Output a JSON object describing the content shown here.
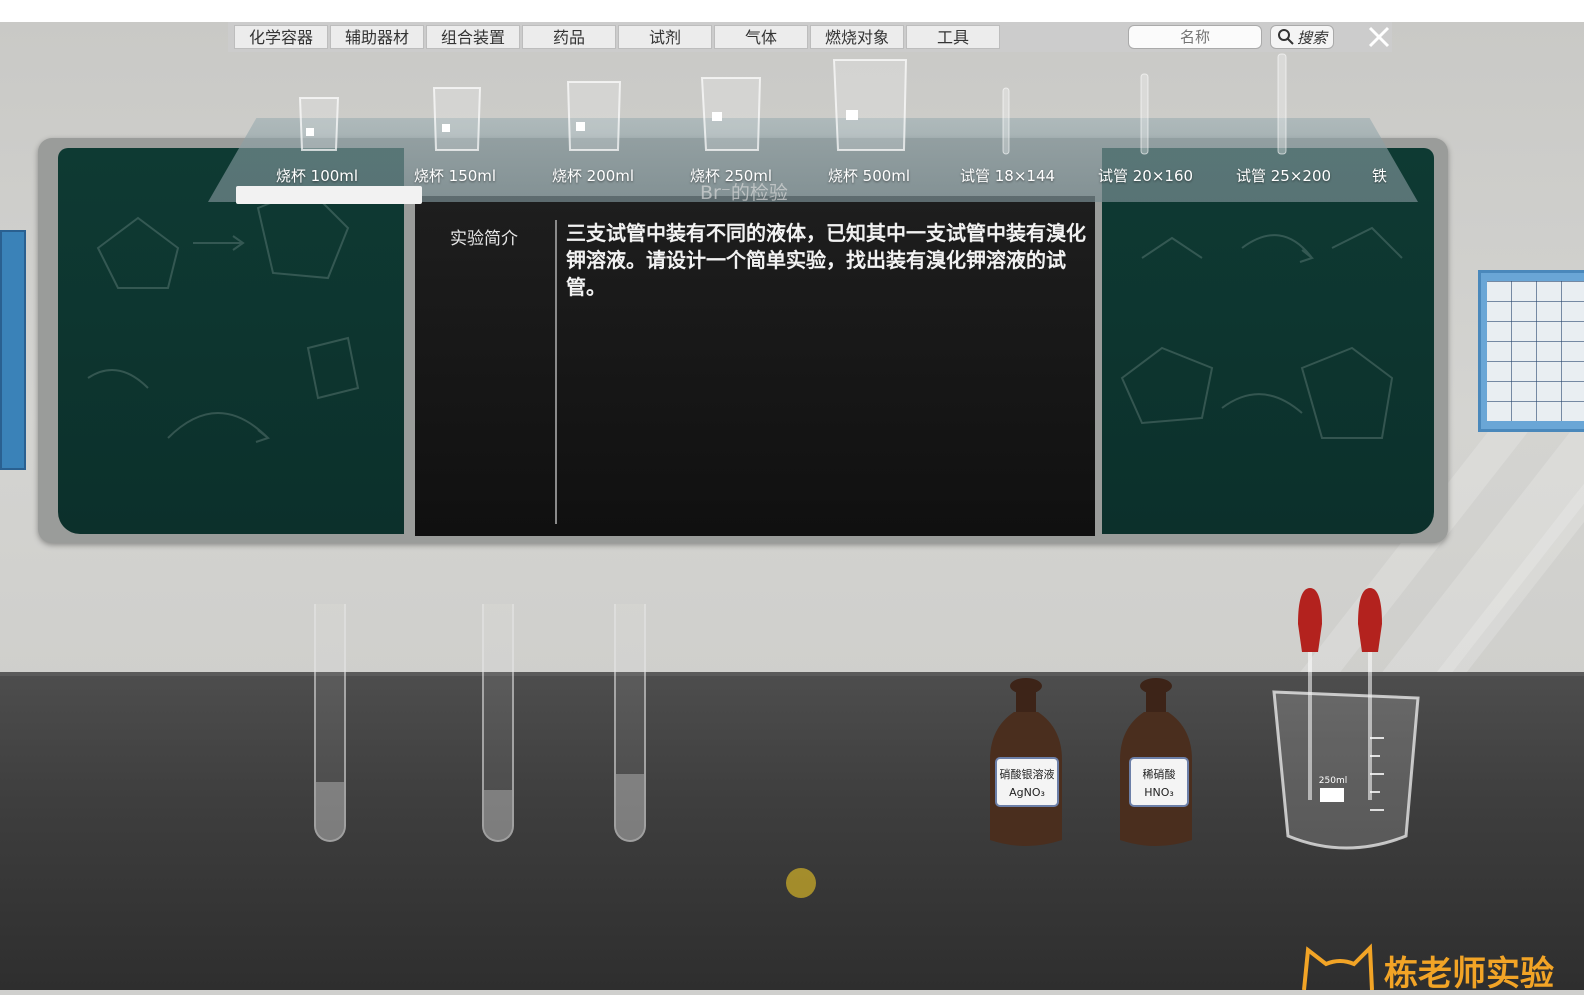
{
  "menu": {
    "tabs": [
      "化学容器",
      "辅助器材",
      "组合装置",
      "药品",
      "试剂",
      "气体",
      "燃烧对象",
      "工具"
    ]
  },
  "search": {
    "placeholder": "名称",
    "button_label": "搜索"
  },
  "shelf": {
    "items": [
      {
        "label": "烧杯 100ml",
        "icon": "beaker-icon"
      },
      {
        "label": "烧杯 150ml",
        "icon": "beaker-icon"
      },
      {
        "label": "烧杯 200ml",
        "icon": "beaker-icon"
      },
      {
        "label": "烧杯 250ml",
        "icon": "beaker-icon"
      },
      {
        "label": "烧杯 500ml",
        "icon": "beaker-icon"
      },
      {
        "label": "试管 18×144",
        "icon": "test-tube-icon"
      },
      {
        "label": "试管 20×160",
        "icon": "test-tube-icon"
      },
      {
        "label": "试管 25×200",
        "icon": "test-tube-icon"
      },
      {
        "label": "铁",
        "icon": "partial-item-icon"
      }
    ],
    "overlay_title": "Br⁻的检验"
  },
  "experiment": {
    "intro_label": "实验简介",
    "intro_text": "三支试管中装有不同的液体，已知其中一支试管中装有溴化钾溶液。请设计一个简单实验，找出装有溴化钾溶液的试管。"
  },
  "bench": {
    "bottles": [
      {
        "label": "硝酸银溶液",
        "formula": "AgNO₃"
      },
      {
        "label": "稀硝酸",
        "formula": "HNO₃"
      }
    ],
    "beaker_label": "250ml"
  },
  "watermark": "栋老师实验",
  "colors": {
    "board": "#0e3a33",
    "bottle": "#4a2e1e",
    "dropper": "#b3221e",
    "accent": "#f2a426"
  }
}
